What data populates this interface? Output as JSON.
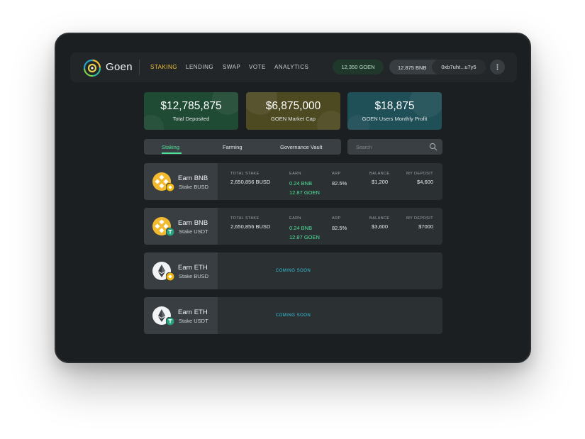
{
  "brand": {
    "name": "Goen"
  },
  "nav": {
    "items": [
      "STAKING",
      "LENDING",
      "SWAP",
      "VOTE",
      "ANALYTICS"
    ],
    "active": "STAKING"
  },
  "wallet": {
    "goen_balance": "12,350 GOEN",
    "bnb_balance": "12.875 BNB",
    "address": "0xb7uht...u7y5",
    "menu_icon": "more-vertical-icon"
  },
  "stats": [
    {
      "value": "$12,785,875",
      "label": "Total Deposited",
      "color": "#1f4a33"
    },
    {
      "value": "$6,875,000",
      "label": "GOEN Market Cap",
      "color": "#4d4a22"
    },
    {
      "value": "$18,875",
      "label": "GOEN Users Monthly Profit",
      "color": "#1f4f57"
    }
  ],
  "tabs": {
    "items": [
      "Staking",
      "Farming",
      "Governance Vault"
    ],
    "active": "Staking"
  },
  "search": {
    "placeholder": "Search",
    "icon": "search-icon"
  },
  "columns": {
    "total_stake": "TOTAL STAKE",
    "earn": "EARN",
    "apr": "ARP",
    "balance": "BALANCE",
    "my_deposit": "MY DEPOSIT"
  },
  "pools": [
    {
      "title": "Earn BNB",
      "subtitle": "Stake BUSD",
      "coin": "bnb-icon",
      "badge": "busd-icon",
      "total_stake": "2,650,856 BUSD",
      "earn_1": "0.24 BNB",
      "earn_2": "12.87 GOEN",
      "apr": "82.5%",
      "balance": "$1,200",
      "my_deposit": "$4,600"
    },
    {
      "title": "Earn BNB",
      "subtitle": "Stake USDT",
      "coin": "bnb-icon",
      "badge": "usdt-icon",
      "total_stake": "2,650,856 BUSD",
      "earn_1": "0.24 BNB",
      "earn_2": "12.87 GOEN",
      "apr": "82.5%",
      "balance": "$3,600",
      "my_deposit": "$7000"
    },
    {
      "title": "Earn ETH",
      "subtitle": "Stake BUSD",
      "coin": "eth-icon",
      "badge": "busd-icon",
      "status": "COMING SOON"
    },
    {
      "title": "Earn ETH",
      "subtitle": "Stake USDT",
      "coin": "eth-icon",
      "badge": "usdt-icon",
      "status": "COMING SOON"
    }
  ],
  "colors": {
    "accent_green": "#4fe39a",
    "nav_active": "#f2c230",
    "coming_soon": "#35c6e0"
  }
}
